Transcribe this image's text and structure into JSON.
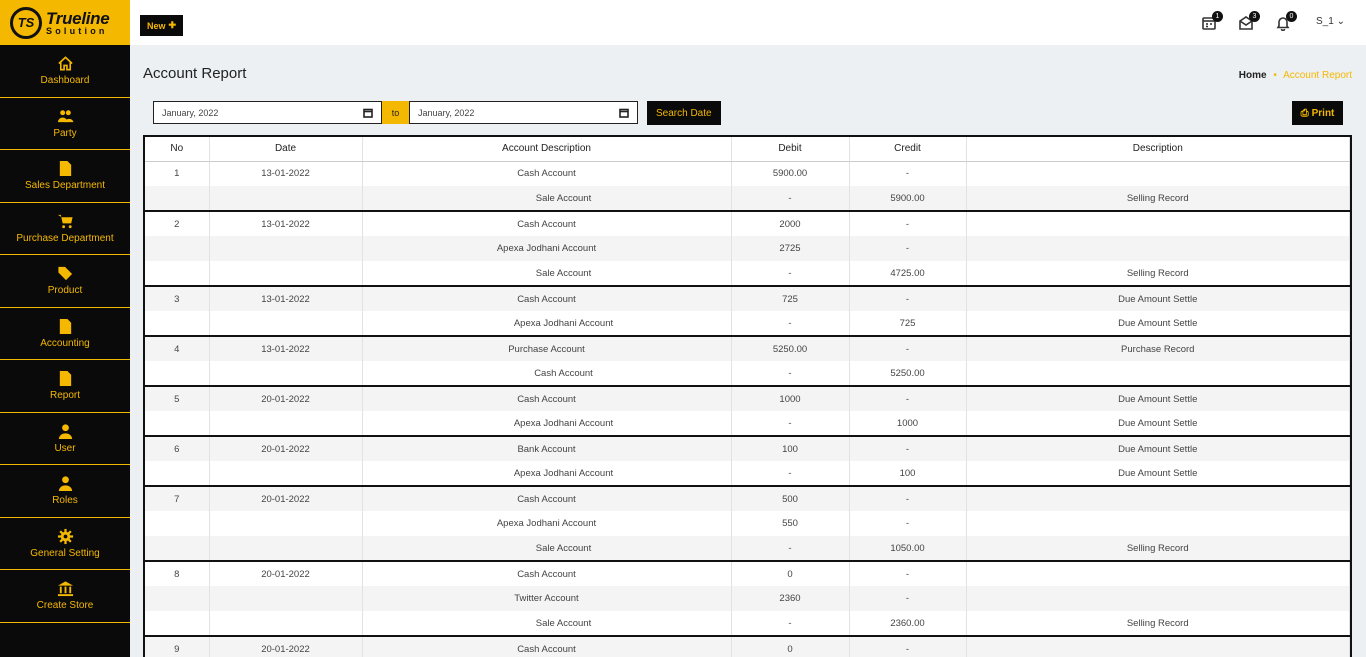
{
  "brand": {
    "mark": "TS",
    "title": "Trueline",
    "subtitle": "Solution"
  },
  "sidebar": {
    "items": [
      {
        "label": "Dashboard",
        "icon": "home-icon"
      },
      {
        "label": "Party",
        "icon": "users-icon"
      },
      {
        "label": "Sales Department",
        "icon": "file-icon"
      },
      {
        "label": "Purchase Department",
        "icon": "cart-icon"
      },
      {
        "label": "Product",
        "icon": "tag-icon"
      },
      {
        "label": "Accounting",
        "icon": "file-icon"
      },
      {
        "label": "Report",
        "icon": "file-icon"
      },
      {
        "label": "User",
        "icon": "user-icon"
      },
      {
        "label": "Roles",
        "icon": "user-icon"
      },
      {
        "label": "General Setting",
        "icon": "gear-icon"
      },
      {
        "label": "Create Store",
        "icon": "bank-icon"
      }
    ]
  },
  "topbar": {
    "new_label": "New",
    "badges": {
      "tasks": "1",
      "mail": "3",
      "notifications": "0"
    },
    "user": "S_1"
  },
  "page": {
    "title": "Account Report",
    "breadcrumb_home": "Home",
    "breadcrumb_sep": "•",
    "breadcrumb_current": "Account Report"
  },
  "filters": {
    "from_date": "January, 2022",
    "to_label": "to",
    "to_date": "January, 2022",
    "search_label": "Search Date",
    "print_label": "Print"
  },
  "table": {
    "headers": [
      "No",
      "Date",
      "Account Description",
      "Debit",
      "Credit",
      "Description"
    ],
    "rows": [
      {
        "no": "1",
        "date": "13-01-2022",
        "account": "Cash Account",
        "debit": "5900.00",
        "credit": "-",
        "desc": "",
        "indent": false,
        "group_start": true
      },
      {
        "no": "",
        "date": "",
        "account": "Sale Account",
        "debit": "-",
        "credit": "5900.00",
        "desc": "Selling Record",
        "indent": true,
        "group_start": false
      },
      {
        "no": "2",
        "date": "13-01-2022",
        "account": "Cash Account",
        "debit": "2000",
        "credit": "-",
        "desc": "",
        "indent": false,
        "group_start": true
      },
      {
        "no": "",
        "date": "",
        "account": "Apexa Jodhani Account",
        "debit": "2725",
        "credit": "-",
        "desc": "",
        "indent": false,
        "group_start": false
      },
      {
        "no": "",
        "date": "",
        "account": "Sale Account",
        "debit": "-",
        "credit": "4725.00",
        "desc": "Selling Record",
        "indent": true,
        "group_start": false
      },
      {
        "no": "3",
        "date": "13-01-2022",
        "account": "Cash Account",
        "debit": "725",
        "credit": "-",
        "desc": "Due Amount Settle",
        "indent": false,
        "group_start": true
      },
      {
        "no": "",
        "date": "",
        "account": "Apexa Jodhani Account",
        "debit": "-",
        "credit": "725",
        "desc": "Due Amount Settle",
        "indent": true,
        "group_start": false
      },
      {
        "no": "4",
        "date": "13-01-2022",
        "account": "Purchase Account",
        "debit": "5250.00",
        "credit": "-",
        "desc": "Purchase Record",
        "indent": false,
        "group_start": true
      },
      {
        "no": "",
        "date": "",
        "account": "Cash Account",
        "debit": "-",
        "credit": "5250.00",
        "desc": "",
        "indent": true,
        "group_start": false
      },
      {
        "no": "5",
        "date": "20-01-2022",
        "account": "Cash Account",
        "debit": "1000",
        "credit": "-",
        "desc": "Due Amount Settle",
        "indent": false,
        "group_start": true
      },
      {
        "no": "",
        "date": "",
        "account": "Apexa Jodhani Account",
        "debit": "-",
        "credit": "1000",
        "desc": "Due Amount Settle",
        "indent": true,
        "group_start": false
      },
      {
        "no": "6",
        "date": "20-01-2022",
        "account": "Bank Account",
        "debit": "100",
        "credit": "-",
        "desc": "Due Amount Settle",
        "indent": false,
        "group_start": true
      },
      {
        "no": "",
        "date": "",
        "account": "Apexa Jodhani Account",
        "debit": "-",
        "credit": "100",
        "desc": "Due Amount Settle",
        "indent": true,
        "group_start": false
      },
      {
        "no": "7",
        "date": "20-01-2022",
        "account": "Cash Account",
        "debit": "500",
        "credit": "-",
        "desc": "",
        "indent": false,
        "group_start": true
      },
      {
        "no": "",
        "date": "",
        "account": "Apexa Jodhani Account",
        "debit": "550",
        "credit": "-",
        "desc": "",
        "indent": false,
        "group_start": false
      },
      {
        "no": "",
        "date": "",
        "account": "Sale Account",
        "debit": "-",
        "credit": "1050.00",
        "desc": "Selling Record",
        "indent": true,
        "group_start": false
      },
      {
        "no": "8",
        "date": "20-01-2022",
        "account": "Cash Account",
        "debit": "0",
        "credit": "-",
        "desc": "",
        "indent": false,
        "group_start": true
      },
      {
        "no": "",
        "date": "",
        "account": "Twitter Account",
        "debit": "2360",
        "credit": "-",
        "desc": "",
        "indent": false,
        "group_start": false
      },
      {
        "no": "",
        "date": "",
        "account": "Sale Account",
        "debit": "-",
        "credit": "2360.00",
        "desc": "Selling Record",
        "indent": true,
        "group_start": false
      },
      {
        "no": "9",
        "date": "20-01-2022",
        "account": "Cash Account",
        "debit": "0",
        "credit": "-",
        "desc": "",
        "indent": false,
        "group_start": true
      }
    ]
  }
}
